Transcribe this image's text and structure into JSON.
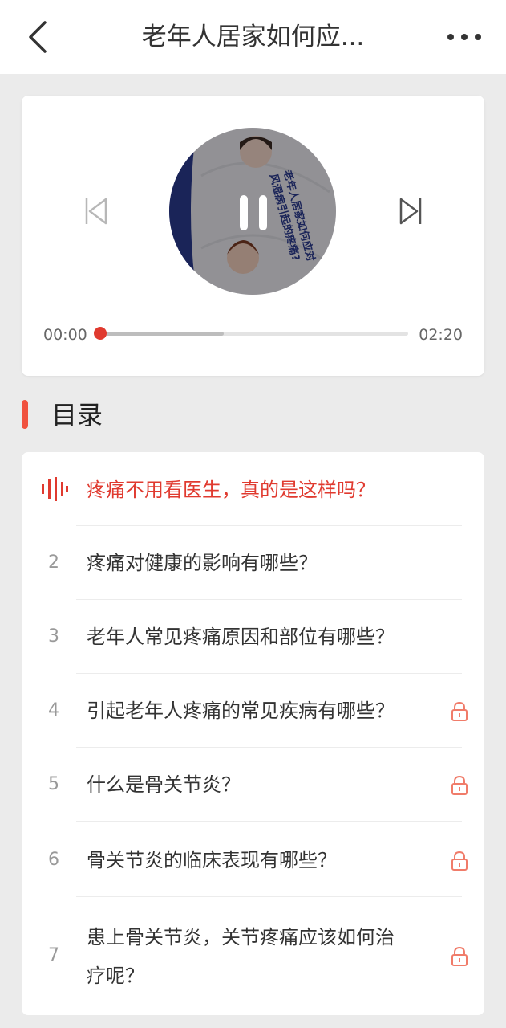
{
  "header": {
    "title": "老年人居家如何应...",
    "back_icon": "back-arrow-icon",
    "more_icon": "more-dots-icon"
  },
  "player": {
    "cover_text": "老年人居家如何应对风湿病引起的疼痛？",
    "state": "playing",
    "current_time": "00:00",
    "total_time": "02:20",
    "progress": 0.0,
    "buffered": 0.4,
    "accent_color": "#e03a2f"
  },
  "catalog": {
    "title": "目录",
    "accent_color": "#f0523f",
    "items": [
      {
        "num": "",
        "label": "疼痛不用看医生，真的是这样吗？",
        "playing": true,
        "locked": false
      },
      {
        "num": "2",
        "label": "疼痛对健康的影响有哪些？",
        "playing": false,
        "locked": false
      },
      {
        "num": "3",
        "label": "老年人常见疼痛原因和部位有哪些？",
        "playing": false,
        "locked": false
      },
      {
        "num": "4",
        "label": "引起老年人疼痛的常见疾病有哪些？",
        "playing": false,
        "locked": true
      },
      {
        "num": "5",
        "label": "什么是骨关节炎？",
        "playing": false,
        "locked": true
      },
      {
        "num": "6",
        "label": "骨关节炎的临床表现有哪些？",
        "playing": false,
        "locked": true
      },
      {
        "num": "7",
        "label_line1": "患上骨关节炎，关节疼痛应该如何治",
        "label_line2": "疗呢？",
        "playing": false,
        "locked": true
      }
    ]
  }
}
